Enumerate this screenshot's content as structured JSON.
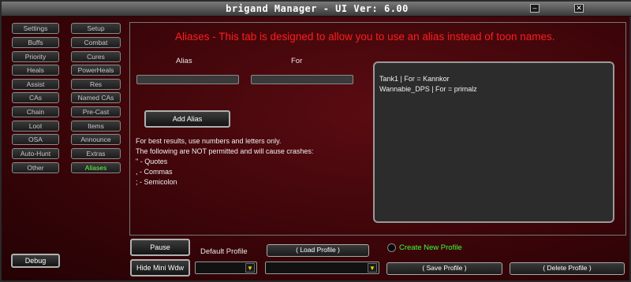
{
  "window": {
    "title": "brigand Manager  - UI Ver: 6.00",
    "minimize_glyph": "–",
    "close_glyph": "✕"
  },
  "sidebar_left": [
    "Settings",
    "Buffs",
    "Priority",
    "Heals",
    "Assist",
    "CAs",
    "Chain",
    "Loot",
    "OSA",
    "Auto-Hunt",
    "Other"
  ],
  "sidebar_right": [
    "Setup",
    "Combat",
    "Cures",
    "PowerHeals",
    "Res",
    "Named CAs",
    "Pre-Cast",
    "Items",
    "Announce",
    "Extras",
    "Aliases"
  ],
  "active_tab": "Aliases",
  "aliases_tab": {
    "heading": "Aliases - This tab is designed to allow you to use an alias instead of toon names.",
    "alias_label": "Alias",
    "for_label": "For",
    "alias_value": "",
    "for_value": "",
    "add_button": "Add Alias",
    "info_lines": [
      "For best results, use numbers and letters only.",
      "The following are NOT permitted and will cause crashes:",
      "\" - Quotes",
      ", - Commas",
      "; - Semicolon"
    ],
    "alias_list": [
      "Tank1 | For = Kannkor",
      "Wannabie_DPS | For = primalz"
    ]
  },
  "bottom": {
    "debug_button": "Debug",
    "pause_button": "Pause",
    "hide_mini_button": "Hide Mini Wdw",
    "default_profile_label": "Default Profile",
    "load_profile_button": "( Load Profile )",
    "create_new_profile_label": "Create New Profile",
    "save_profile_button": "( Save Profile )",
    "delete_profile_button": "( Delete Profile )",
    "dropdown_arrow": "▼"
  },
  "colors": {
    "heading": "#ff1d1d",
    "active_tab": "#6dff4a",
    "create_profile": "#3cff3c",
    "background": "#4a070c"
  }
}
